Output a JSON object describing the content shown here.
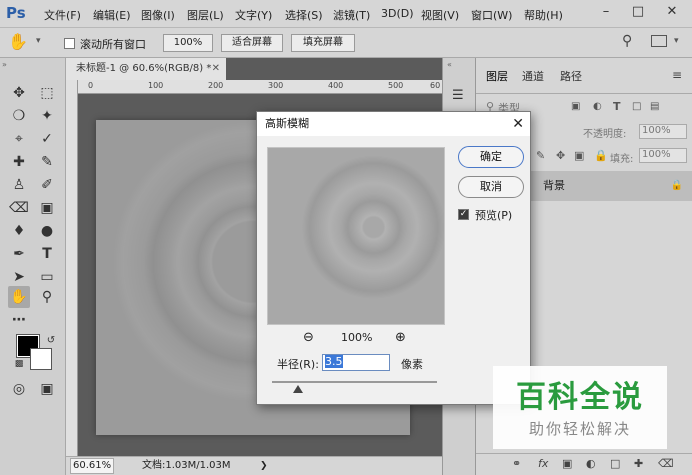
{
  "app": {
    "logo": "Ps",
    "menu": [
      "文件(F)",
      "编辑(E)",
      "图像(I)",
      "图层(L)",
      "文字(Y)",
      "选择(S)",
      "滤镜(T)",
      "3D(D)",
      "视图(V)",
      "窗口(W)",
      "帮助(H)"
    ]
  },
  "options": {
    "scroll_all_label": "滚动所有窗口",
    "zoom_btn": "100%",
    "fit_screen_btn": "适合屏幕",
    "fill_screen_btn": "填充屏幕"
  },
  "document": {
    "tab_title": "未标题-1 @ 60.6%(RGB/8) *",
    "ruler_labels": [
      "0",
      "100",
      "200",
      "300",
      "400",
      "500",
      "60"
    ],
    "zoom": "60.61%",
    "doc_info": "文档:1.03M/1.03M"
  },
  "panel": {
    "tabs": [
      "图层",
      "通道",
      "路径"
    ],
    "filter_label": "类型",
    "opacity_label": "不透明度:",
    "opacity_value": "100%",
    "fill_label": "填充:",
    "fill_value": "100%",
    "layer_name": "背景"
  },
  "dialog": {
    "title": "高斯模糊",
    "ok": "确定",
    "cancel": "取消",
    "preview_label": "预览(P)",
    "zoom_level": "100%",
    "radius_label": "半径(R):",
    "radius_value": "3.5",
    "unit": "像素",
    "radius_slider_fraction": 0.16
  },
  "watermark": {
    "title": "百科全说",
    "subtitle": "助你轻松解决"
  },
  "colors": {
    "accent_blue": "#3b78d8",
    "watermark_green": "#2a9b3e",
    "ps_blue": "#2c5fa8"
  }
}
